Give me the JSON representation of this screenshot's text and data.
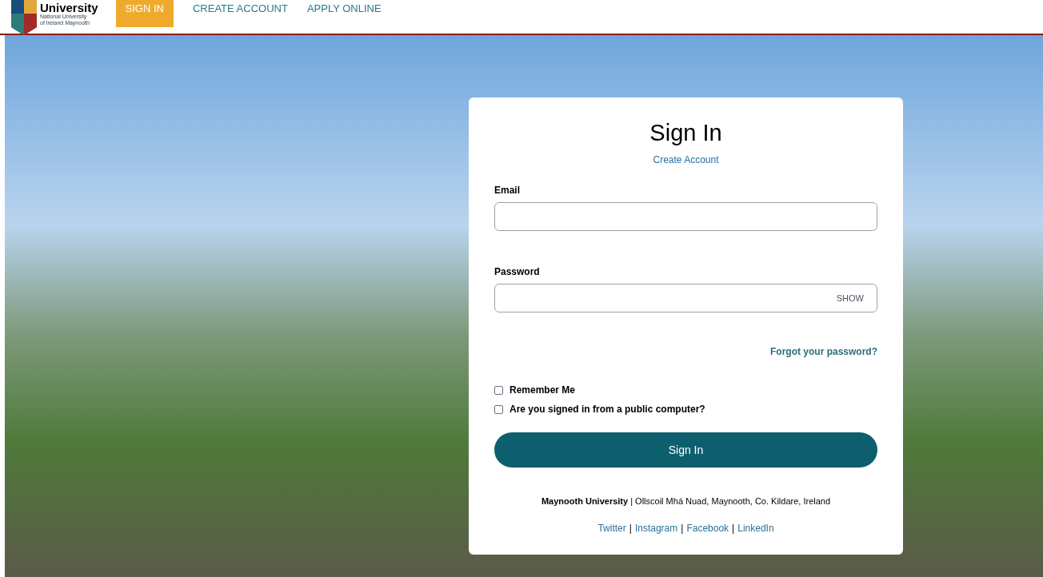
{
  "logo": {
    "name": "University",
    "subtitle": "National University of Ireland Maynooth"
  },
  "nav": [
    {
      "label": "SIGN IN",
      "selected": true
    },
    {
      "label": "CREATE ACCOUNT",
      "selected": false
    },
    {
      "label": "APPLY ONLINE",
      "selected": false
    }
  ],
  "card": {
    "title": "Sign In",
    "create_link": "Create Account",
    "fields": [
      {
        "label": "Email"
      },
      {
        "label": "Password",
        "toggle": "SHOW"
      }
    ],
    "forgot": "Forgot your password?",
    "checkboxes": [
      {
        "label": "Remember Me",
        "checked": false
      },
      {
        "label": "Are you signed in from a public computer?",
        "checked": false
      }
    ],
    "submit": "Sign In",
    "address": "**Maynooth University** | Ollscoil Mhá Nuad, Maynooth, Co. Kildare, Ireland",
    "social": [
      "Twitter",
      "Instagram",
      "Facebook",
      "LinkedIn"
    ],
    "separator": "|"
  }
}
